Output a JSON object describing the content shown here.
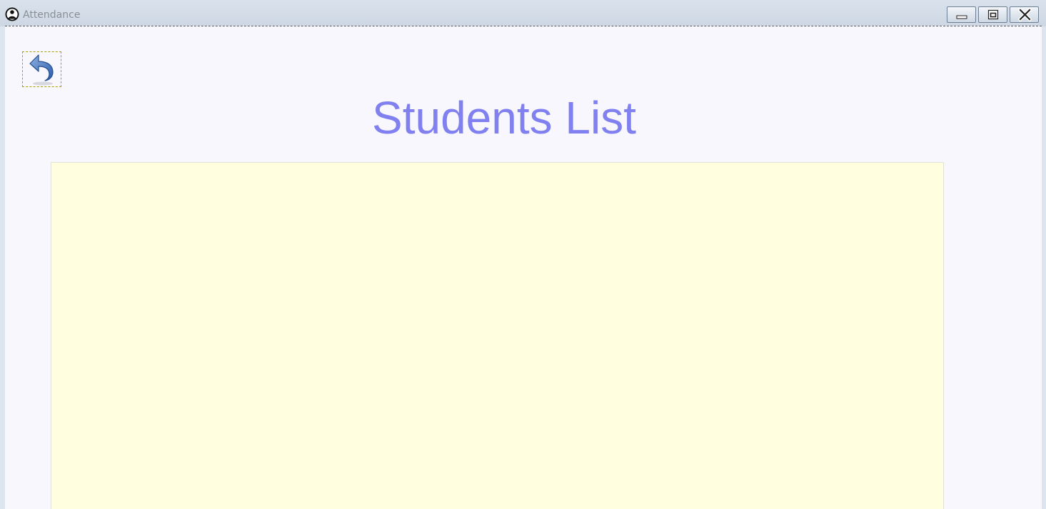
{
  "window": {
    "title": "Attendance",
    "app_icon": "person-silhouette-icon",
    "controls": {
      "minimize_icon": "minimize-icon",
      "maximize_icon": "restore-icon",
      "close_icon": "close-icon"
    }
  },
  "main": {
    "back_icon": "undo-arrow-icon",
    "title": "Students List",
    "panel": {
      "rows": []
    }
  },
  "colors": {
    "title": "#8080f0",
    "panel_background": "#ffffdf",
    "client_background": "#f7f7fd"
  }
}
